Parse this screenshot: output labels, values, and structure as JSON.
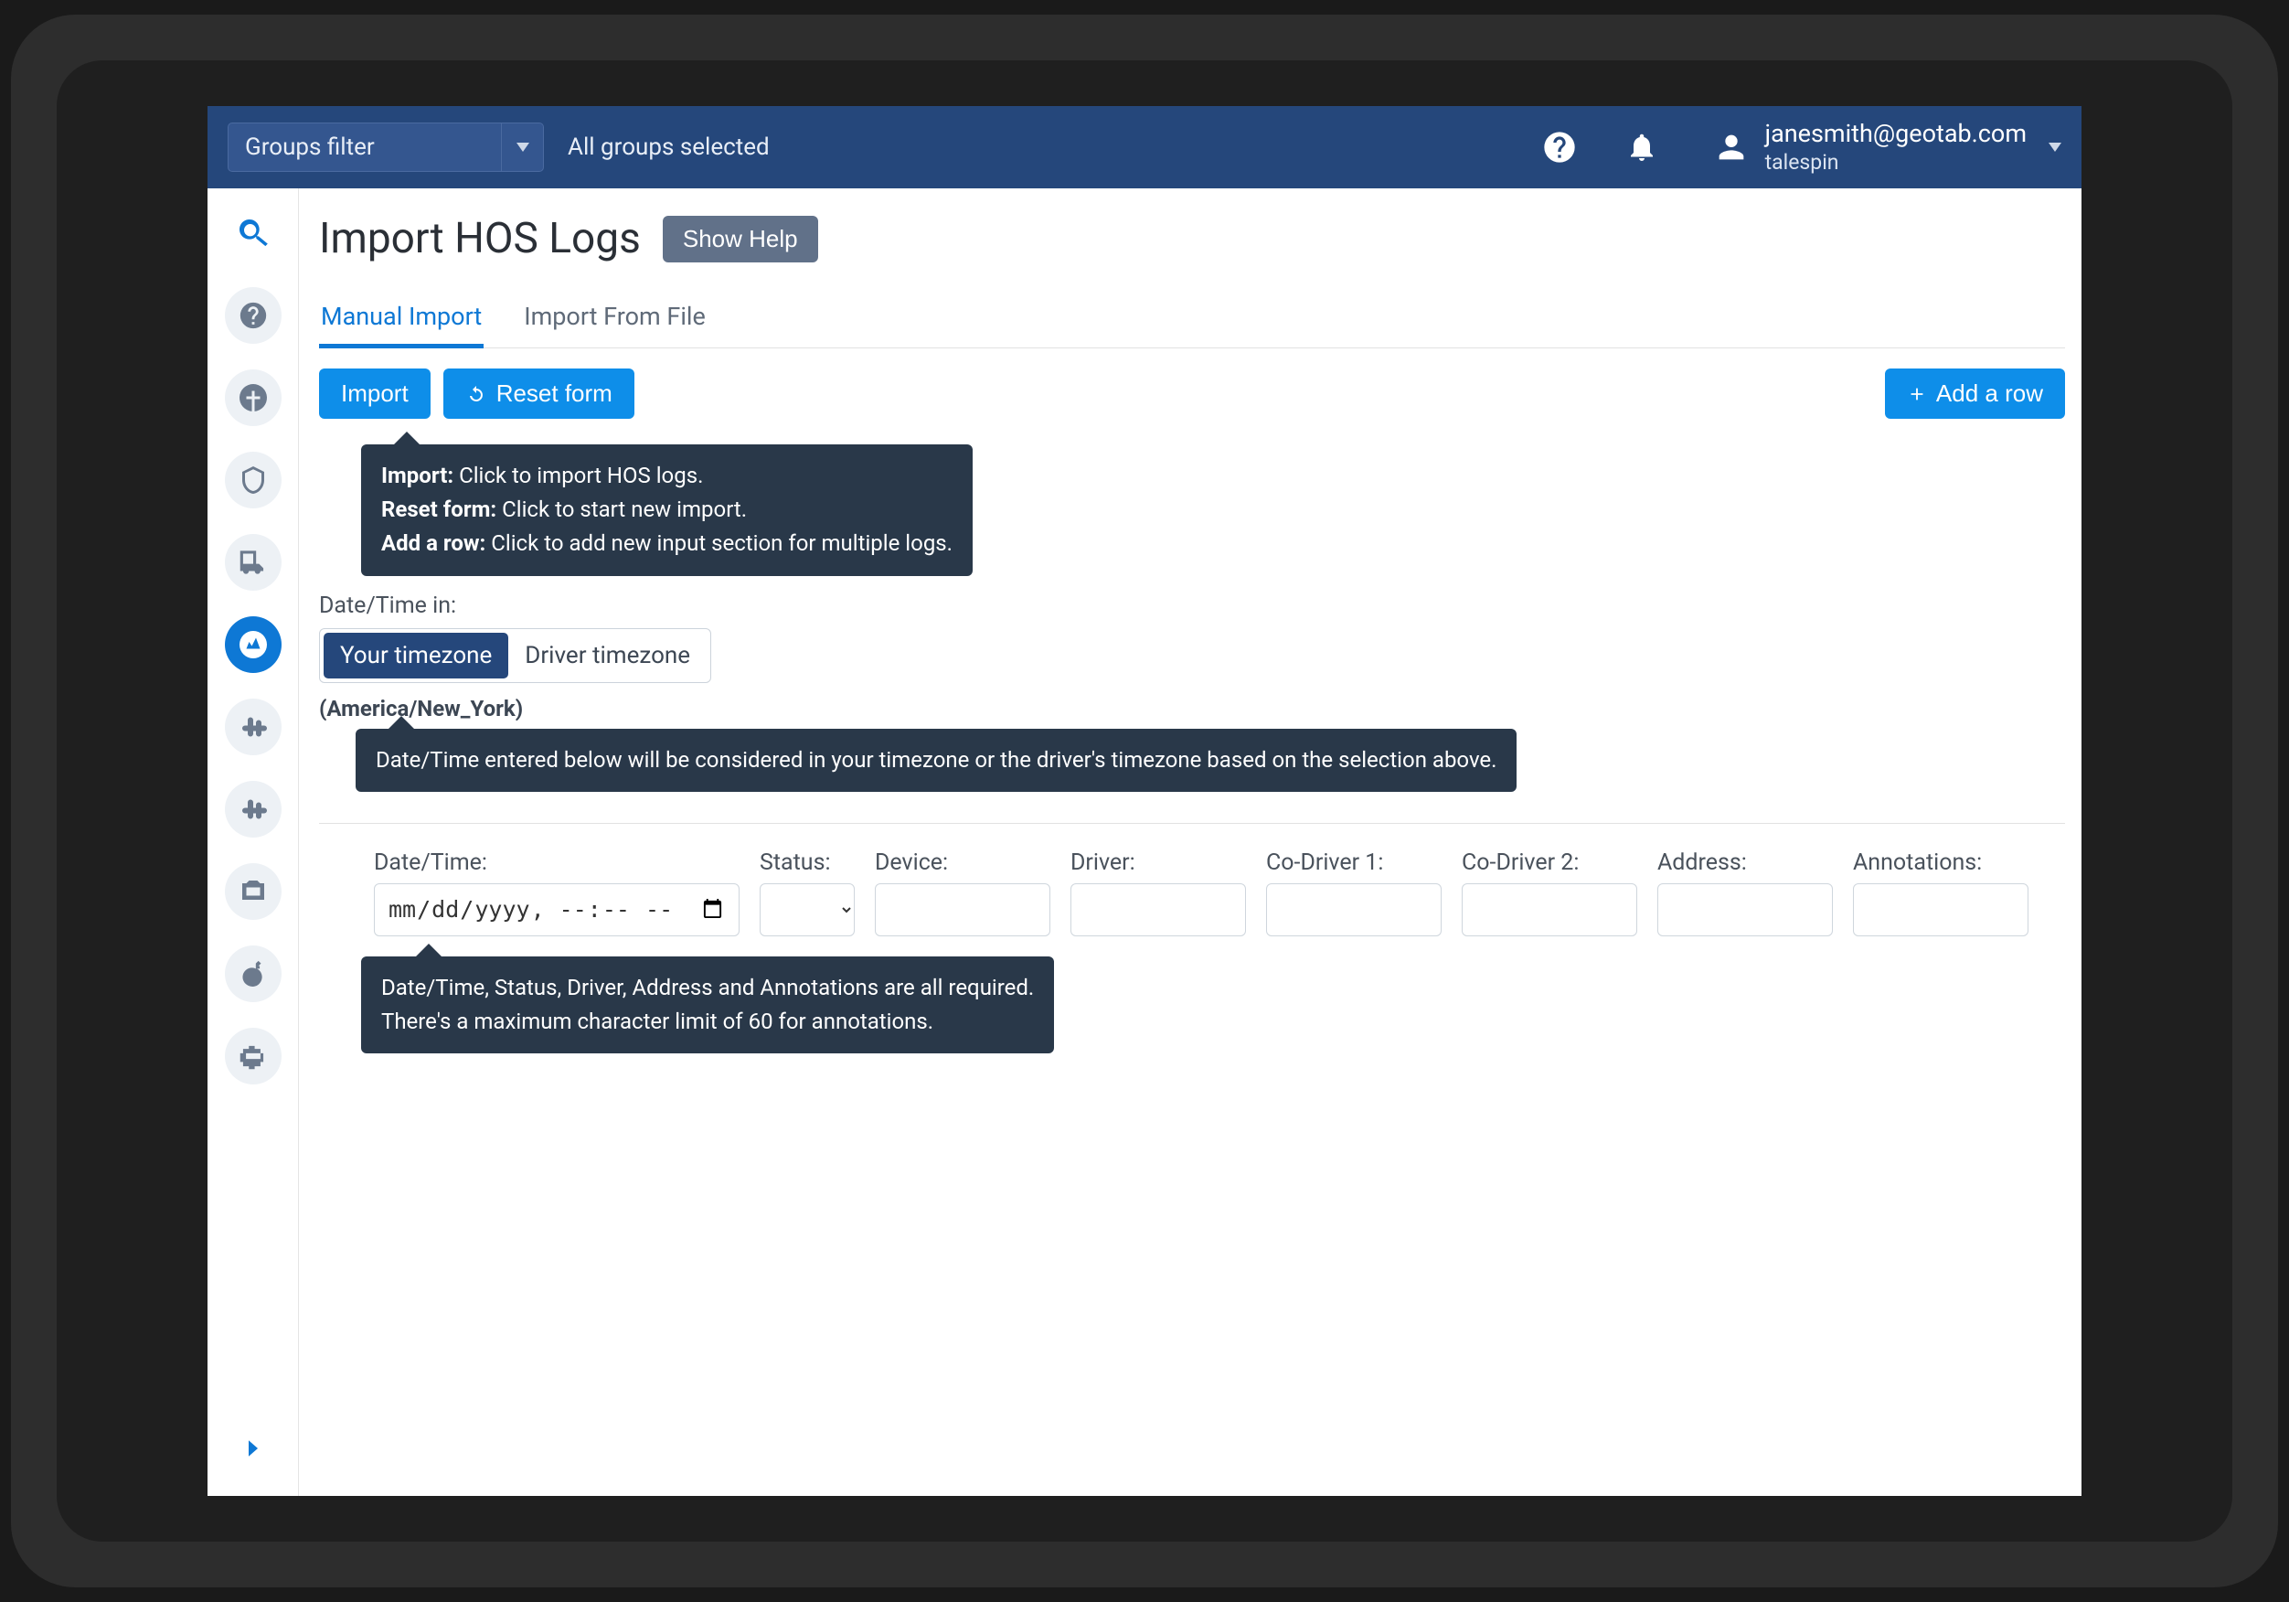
{
  "topbar": {
    "groups_filter_placeholder": "Groups filter",
    "all_groups": "All groups selected",
    "user_email": "janesmith@geotab.com",
    "company": "talespin"
  },
  "page": {
    "title": "Import HOS Logs",
    "show_help": "Show Help"
  },
  "tabs": {
    "manual": "Manual Import",
    "file": "Import From File"
  },
  "actions": {
    "import": "Import",
    "reset": "Reset form",
    "add_row": "Add a row"
  },
  "tooltips": {
    "t1_a_label": "Import:",
    "t1_a_text": " Click to import HOS logs.",
    "t1_b_label": "Reset form:",
    "t1_b_text": " Click to start new import.",
    "t1_c_label": "Add a row:",
    "t1_c_text": " Click to add new input section for multiple logs.",
    "t2": "Date/Time entered below will be considered in your timezone or the driver's timezone based on the selection above.",
    "t3_line1": "Date/Time, Status, Driver, Address and Annotations are all required.",
    "t3_line2": "There's a maximum character limit of 60 for annotations."
  },
  "tz": {
    "label": "Date/Time in:",
    "your": "Your timezone",
    "driver": "Driver timezone",
    "current": "(America/New_York)"
  },
  "fields": {
    "datetime": "Date/Time:",
    "datetime_placeholder": "mm/dd/yyyy --:-- --",
    "status": "Status:",
    "device": "Device:",
    "driver": "Driver:",
    "codriver1": "Co-Driver 1:",
    "codriver2": "Co-Driver 2:",
    "address": "Address:",
    "annotations": "Annotations:"
  }
}
